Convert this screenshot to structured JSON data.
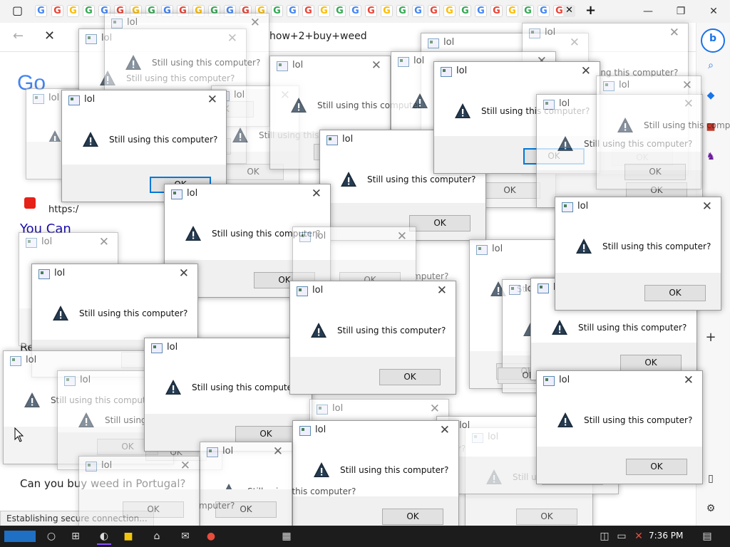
{
  "browser": {
    "address_text": "how+2+buy+weed",
    "window_buttons": {
      "minimize": "—",
      "restore": "❐",
      "close": "✕"
    },
    "tab_icons": [
      "G",
      "G",
      "G",
      "G",
      "G",
      "G",
      "G",
      "G",
      "G",
      "G",
      "G",
      "G",
      "G",
      "G",
      "G",
      "G",
      "G",
      "G",
      "G",
      "G",
      "G",
      "G",
      "G",
      "G",
      "G",
      "G",
      "G",
      "G",
      "G",
      "G",
      "G",
      "G",
      "G",
      "G",
      "G"
    ],
    "new_tab": "+",
    "close_tab": "✕"
  },
  "page": {
    "snippets": [
      {
        "text": "Go",
        "style": "google-logo"
      },
      {
        "text": "You Can",
        "style": "link-large"
      },
      {
        "text": "https:/",
        "style": "url"
      },
      {
        "text": "Can you buy weed in Portugal?",
        "style": "question"
      },
      {
        "text": "Re",
        "style": "heading"
      }
    ],
    "status_text": "Establishing secure connection..."
  },
  "dialogs": [
    {
      "title": "lol",
      "message": "Still using this computer?",
      "ok": "OK"
    }
  ],
  "taskbar": {
    "time": "7:36 PM"
  },
  "colors": {
    "warning": "#1b2b3a",
    "focus_border": "#0078d7",
    "taskbar": "#1c1c1c"
  }
}
